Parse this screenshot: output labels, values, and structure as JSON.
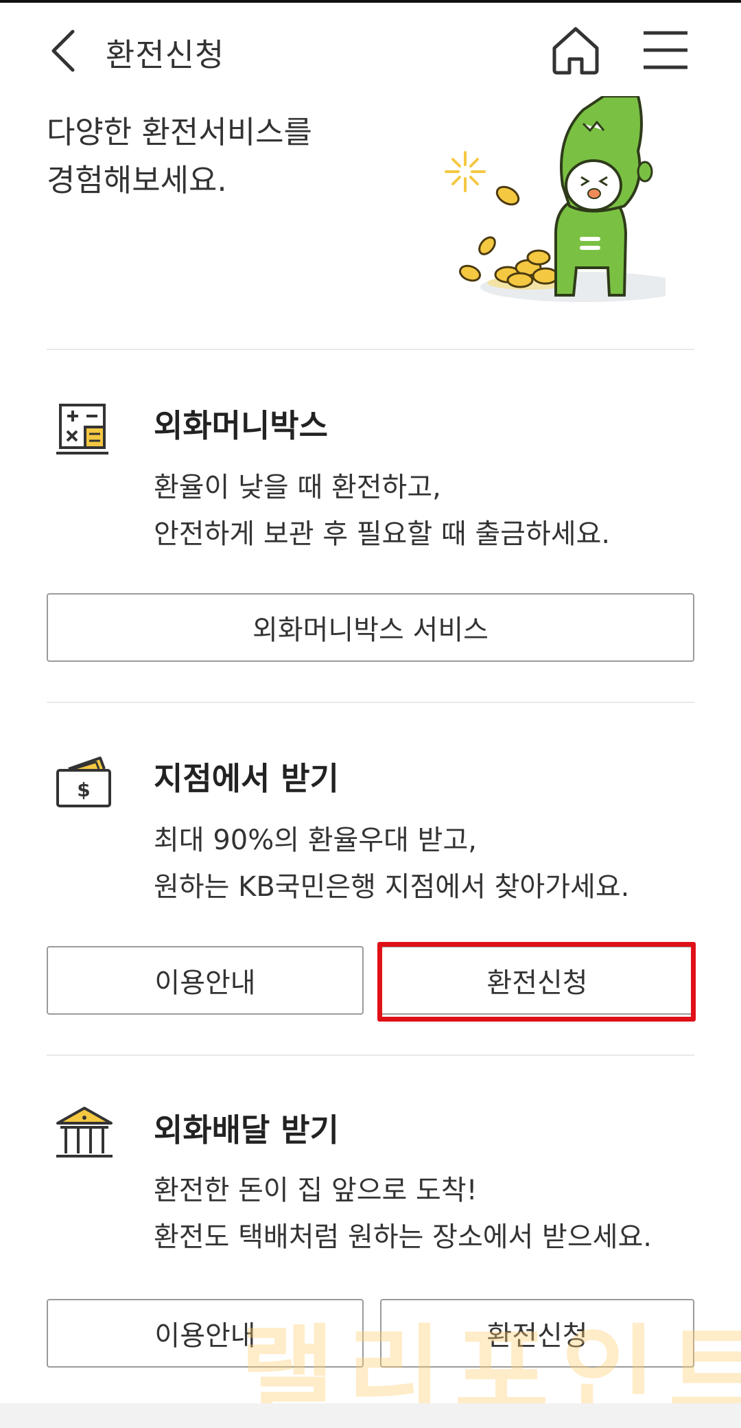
{
  "header": {
    "title": "환전신청"
  },
  "intro": {
    "line1": "다양한 환전서비스를",
    "line2": "경험해보세요."
  },
  "sections": [
    {
      "title": "외화머니박스",
      "desc_line1": "환율이 낮을 때 환전하고,",
      "desc_line2": "안전하게 보관 후 필요할 때 출금하세요.",
      "buttons": [
        "외화머니박스 서비스"
      ]
    },
    {
      "title": "지점에서 받기",
      "desc_line1": "최대 90%의 환율우대 받고,",
      "desc_line2": "원하는 KB국민은행 지점에서 찾아가세요.",
      "buttons": [
        "이용안내",
        "환전신청"
      ]
    },
    {
      "title": "외화배달 받기",
      "desc_line1": "환전한 돈이 집 앞으로 도착!",
      "desc_line2": "환전도 택배처럼 원하는 장소에서 받으세요.",
      "buttons": [
        "이용안내",
        "환전신청"
      ]
    }
  ],
  "watermark": "랠리포인트",
  "colors": {
    "accent_yellow": "#f5c842",
    "highlight_red": "#e01018",
    "mascot_green": "#7ac143"
  },
  "icons": [
    "back-arrow-icon",
    "home-icon",
    "menu-icon",
    "calculator-icon",
    "wallet-icon",
    "bank-icon"
  ]
}
